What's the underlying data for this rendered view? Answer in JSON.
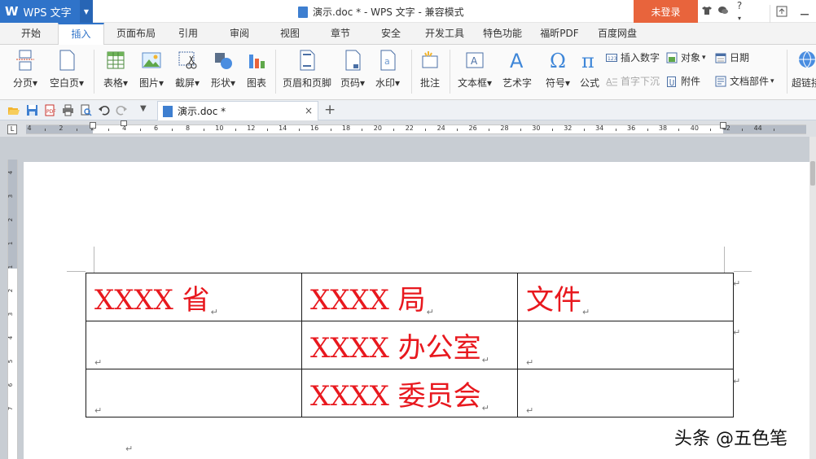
{
  "titlebar": {
    "app_name": "WPS 文字",
    "logo": "W",
    "document_title": "演示.doc * - WPS 文字 - 兼容模式",
    "login_label": "未登录",
    "help_label": "?",
    "icons": [
      "shirt-icon",
      "chat-icon",
      "help-icon",
      "restore-icon",
      "minimize-icon"
    ]
  },
  "tabs": [
    {
      "label": "开始"
    },
    {
      "label": "插入"
    },
    {
      "label": "页面布局"
    },
    {
      "label": "引用"
    },
    {
      "label": "审阅"
    },
    {
      "label": "视图"
    },
    {
      "label": "章节"
    },
    {
      "label": "安全"
    },
    {
      "label": "开发工具"
    },
    {
      "label": "特色功能"
    },
    {
      "label": "福昕PDF"
    },
    {
      "label": "百度网盘"
    }
  ],
  "active_tab": "插入",
  "ribbon": {
    "buttons": [
      {
        "label": "分页",
        "dropdown": true
      },
      {
        "label": "空白页",
        "dropdown": true
      },
      {
        "label": "表格",
        "dropdown": true
      },
      {
        "label": "图片",
        "dropdown": true
      },
      {
        "label": "截屏",
        "dropdown": true
      },
      {
        "label": "形状",
        "dropdown": true
      },
      {
        "label": "图表",
        "dropdown": false
      },
      {
        "label": "页眉和页脚",
        "dropdown": false
      },
      {
        "label": "页码",
        "dropdown": true
      },
      {
        "label": "水印",
        "dropdown": true
      },
      {
        "label": "批注",
        "dropdown": false
      },
      {
        "label": "文本框",
        "dropdown": true
      },
      {
        "label": "艺术字",
        "dropdown": false
      },
      {
        "label": "符号",
        "dropdown": true
      },
      {
        "label": "公式",
        "dropdown": false
      },
      {
        "label": "超链接",
        "dropdown": false
      }
    ],
    "small_buttons": {
      "insert_number": "插入数字",
      "object": "对象",
      "date": "日期",
      "drop_cap": "首字下沉",
      "attachment": "附件",
      "doc_parts": "文档部件"
    },
    "dropdown_glyph": "▾"
  },
  "quickbar": {
    "doc_tab_title": "演示.doc *",
    "close_glyph": "×",
    "new_tab_glyph": "+"
  },
  "ruler": {
    "labels": [
      "4",
      "2",
      "2",
      "4",
      "6",
      "8",
      "10",
      "12",
      "14",
      "16",
      "18",
      "20",
      "22",
      "24",
      "26",
      "28",
      "30",
      "32",
      "34",
      "36",
      "38",
      "40",
      "42",
      "44"
    ],
    "vertical_labels": [
      "4",
      "3",
      "2",
      "1",
      "1",
      "2",
      "3",
      "4",
      "5",
      "6",
      "7"
    ],
    "corner_glyph": "L"
  },
  "document": {
    "table": [
      [
        "XXXX 省",
        "XXXX 局",
        "文件"
      ],
      [
        "",
        "XXXX 办公室",
        ""
      ],
      [
        "",
        "XXXX 委员会",
        ""
      ]
    ],
    "paragraph_mark": "↵",
    "text_color": "#e8181e"
  },
  "watermark": "头条 @五色笔",
  "colors": {
    "brand_blue": "#2f73c9",
    "login_orange": "#e8643c",
    "table_text_red": "#e8181e"
  }
}
